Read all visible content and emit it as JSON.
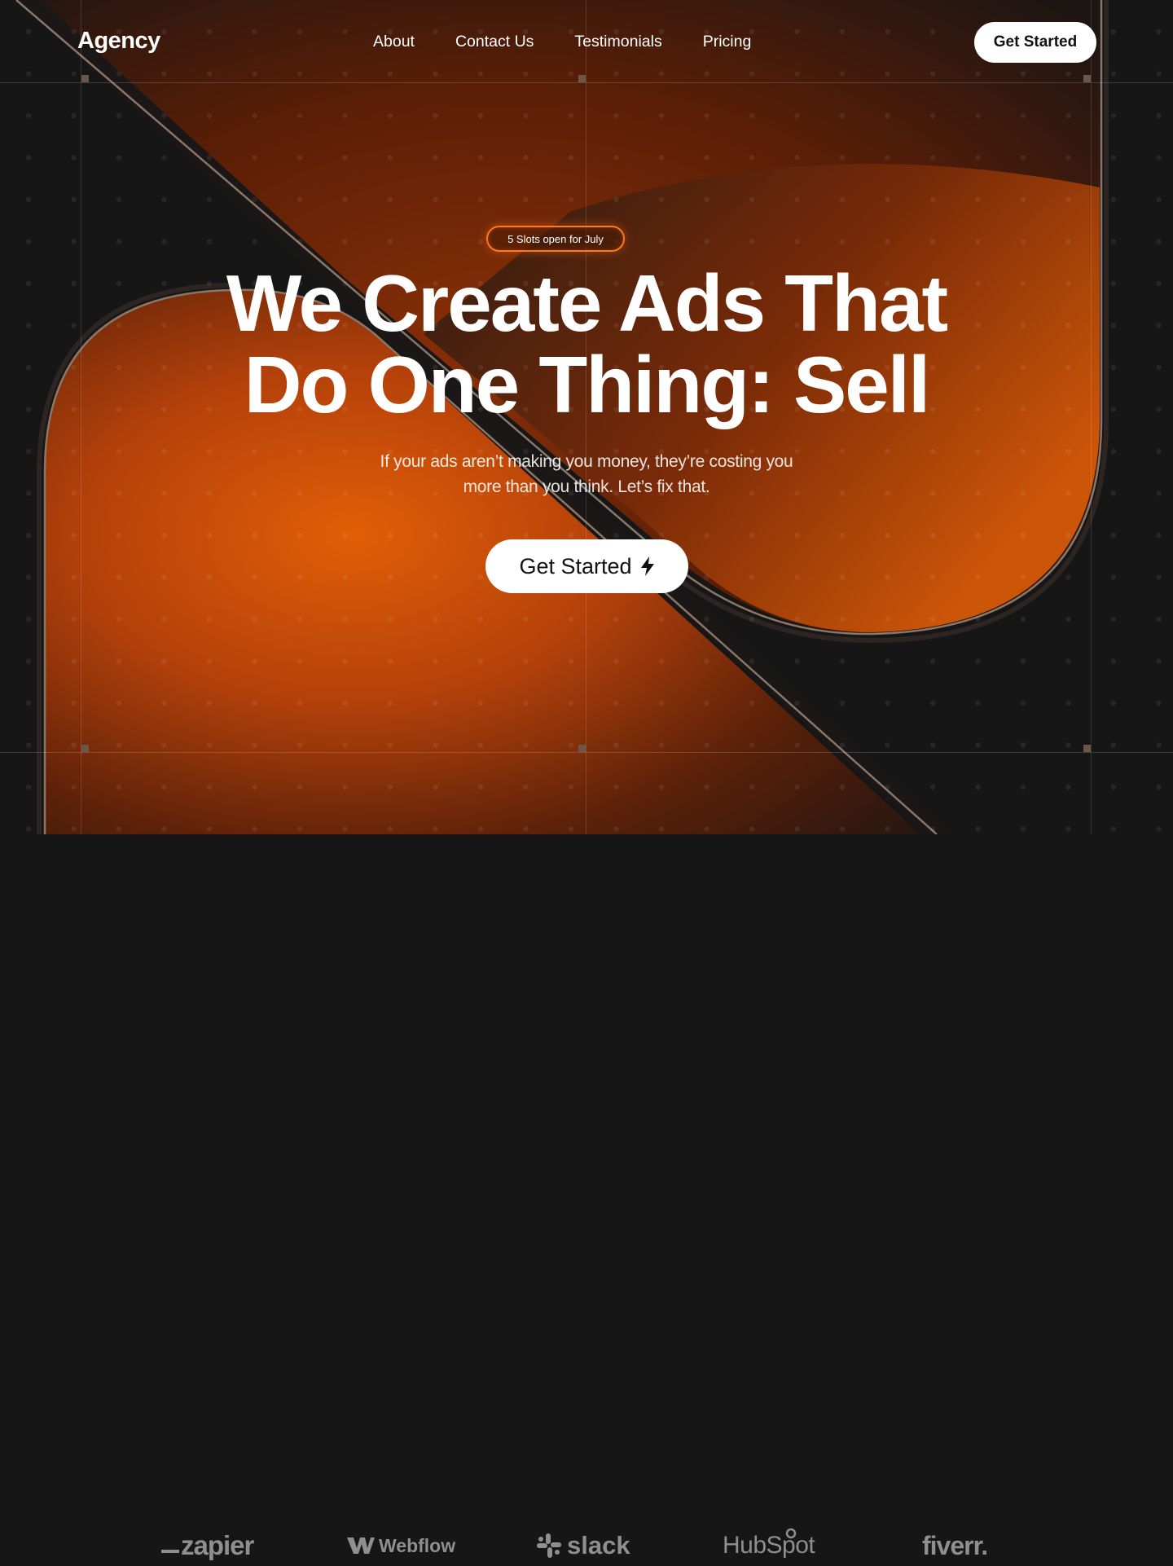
{
  "header": {
    "logo": "Agency",
    "nav": [
      "About",
      "Contact Us",
      "Testimonials",
      "Pricing"
    ],
    "cta_label": "Get Started"
  },
  "hero": {
    "badge": "5 Slots open for July",
    "headline_line1": "We Create Ads That",
    "headline_line2": "Do One Thing: Sell",
    "sub_line1": "If your ads aren’t making you money, they’re costing you",
    "sub_line2": "more than you think. Let’s fix that.",
    "cta_label": "Get Started",
    "cta_icon": "lightning-bolt-icon"
  },
  "logos": [
    "zapier",
    "Webflow",
    "slack",
    "HubSpot",
    "fiverr."
  ],
  "colors": {
    "background": "#171616",
    "accent_orange": "#e0600a",
    "deep_orange": "#6a2208",
    "button_bg": "#ffffff",
    "button_text": "#111111",
    "logo_gray": "#8f8f8f"
  }
}
